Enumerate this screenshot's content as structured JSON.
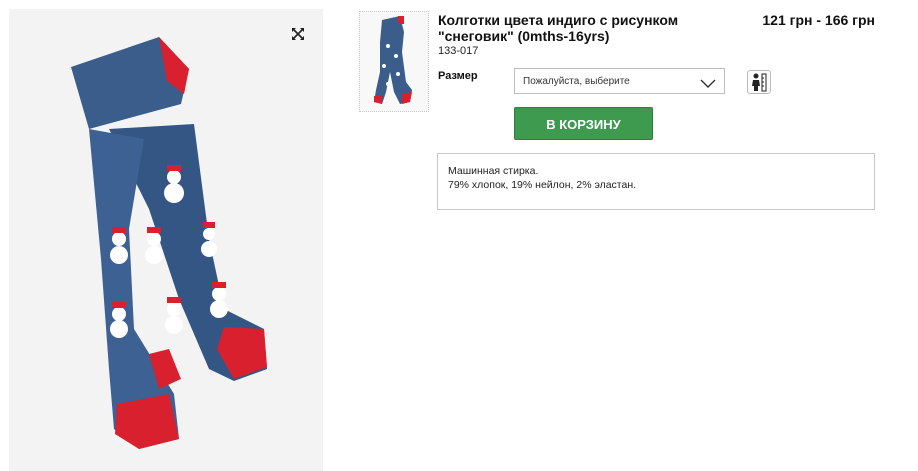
{
  "product": {
    "title": "Колготки цвета индиго с рисунком \"снеговик\" (0mths-16yrs)",
    "price": "121 грн - 166 грн",
    "code": "133-017",
    "main_image_alt": "Колготки цвета индиго с рисунком снеговик"
  },
  "size": {
    "label": "Размер",
    "selected": "Пожалуйста, выберите"
  },
  "cart": {
    "button_label": "В КОРЗИНУ"
  },
  "description": {
    "line1": "Машинная стирка.",
    "line2": "79% хлопок, 19% нейлон, 2% эластан."
  },
  "colors": {
    "tights_blue": "#3a5d8c",
    "tights_red": "#d9202e",
    "cart_green": "#3e9a4e",
    "image_bg": "#f3f3f3"
  },
  "icons": {
    "expand": "expand-icon",
    "chevron": "chevron-down-icon",
    "size_guide": "size-guide-icon"
  }
}
